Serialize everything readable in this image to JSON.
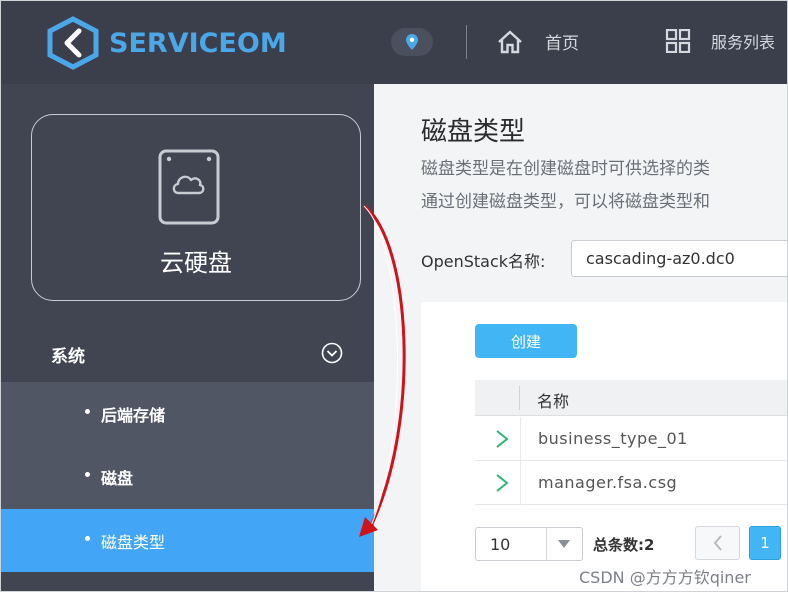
{
  "header": {
    "logo_text": "SERVICEOM",
    "brand_color": "#4aa7e8",
    "location_icon": "map-pin-icon",
    "home_label": "首页",
    "home_icon": "home-icon",
    "services_label": "服务列表",
    "services_icon": "grid-icon"
  },
  "sidebar": {
    "card_label": "云硬盘",
    "card_icon": "cloud-disk-icon",
    "section_label": "系统",
    "section_icon": "chevron-down-circle-icon",
    "items": [
      {
        "label": "后端存储",
        "active": false
      },
      {
        "label": "磁盘",
        "active": false
      },
      {
        "label": "磁盘类型",
        "active": true
      }
    ],
    "active_color": "#42a5f5"
  },
  "main": {
    "title": "磁盘类型",
    "desc_line1": "磁盘类型是在创建磁盘时可供选择的类",
    "desc_line2": "通过创建磁盘类型，可以将磁盘类型和",
    "openstack_label": "OpenStack名称:",
    "openstack_value": "cascading-az0.dc0",
    "create_button": "创建",
    "table": {
      "columns": [
        "名称"
      ],
      "rows": [
        {
          "name": "business_type_01"
        },
        {
          "name": "manager.fsa.csg"
        }
      ]
    },
    "pager": {
      "page_size": "10",
      "total_label": "总条数:2",
      "current_page": "1"
    }
  },
  "watermark": "CSDN @方方方钦qiner",
  "annotation_color": "#d0121b"
}
